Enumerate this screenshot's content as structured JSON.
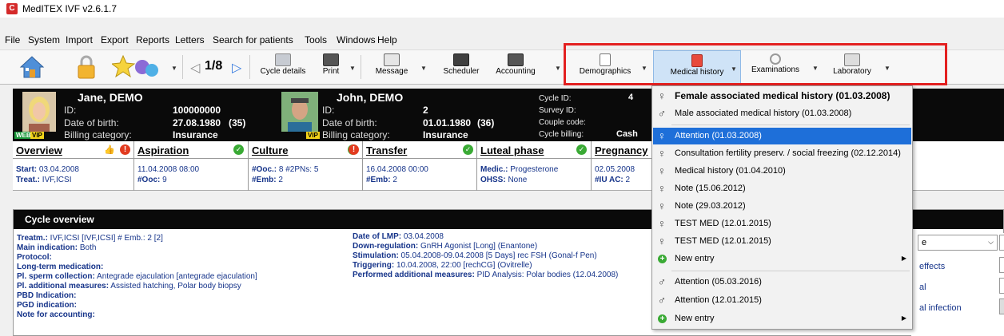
{
  "window": {
    "title": "MedITEX IVF v2.6.1.7",
    "app_icon": "C"
  },
  "menubar": [
    "File",
    "System",
    "Import",
    "Export",
    "Reports",
    "Letters",
    "Search for patients",
    "Tools",
    "Windows",
    "Help"
  ],
  "toolbar": {
    "pager": "1/8",
    "cycle_details": "Cycle details",
    "print": "Print",
    "message": "Message",
    "scheduler": "Scheduler",
    "accounting": "Accounting",
    "demographics": "Demographics",
    "medical_history": "Medical history",
    "examinations": "Examinations",
    "laboratory": "Laboratory"
  },
  "female": {
    "name": "Jane, DEMO",
    "id_label": "ID:",
    "id": "100000000",
    "dob_label": "Date of birth:",
    "dob": "27.08.1980",
    "age": "(35)",
    "billing_label": "Billing category:",
    "billing": "Insurance",
    "web_badge": "WEB",
    "vip_badge": "VIP"
  },
  "male": {
    "name": "John, DEMO",
    "id_label": "ID:",
    "id": "2",
    "dob_label": "Date of birth:",
    "dob": "01.01.1980",
    "age": "(36)",
    "billing_label": "Billing category:",
    "billing": "Insurance",
    "vip_badge": "VIP"
  },
  "cycle": {
    "cycle_id_label": "Cycle ID:",
    "cycle_id": "4",
    "survey_id_label": "Survey ID:",
    "couple_code_label": "Couple code:",
    "cycle_billing_label": "Cycle billing:",
    "cycle_billing": "Cash"
  },
  "phases": [
    {
      "title": "Overview",
      "l1a": "Start:",
      "l1b": " 03.04.2008",
      "l2a": "Treat.:",
      "l2b": " IVF,ICSI"
    },
    {
      "title": "Aspiration",
      "l1a": "",
      "l1b": "11.04.2008 08:00",
      "l2a": "#Ooc:",
      "l2b": " 9"
    },
    {
      "title": "Culture",
      "l1a": "#Ooc.:",
      "l1b": " 8 #2PNs: 5",
      "l2a": "#Emb:",
      "l2b": " 2"
    },
    {
      "title": "Transfer",
      "l1a": "",
      "l1b": "16.04.2008 00:00",
      "l2a": "#Emb:",
      "l2b": " 2"
    },
    {
      "title": "Luteal phase",
      "l1a": "Medic.:",
      "l1b": " Progesterone",
      "l2a": "OHSS:",
      "l2b": " None"
    },
    {
      "title": "Pregnancy",
      "l1a": "",
      "l1b": "02.05.2008",
      "l2a": "#IU AC:",
      "l2b": " 2"
    }
  ],
  "overview": {
    "header": "Cycle overview",
    "left": [
      {
        "k": "Treatm.:",
        "v": " IVF,ICSI    [IVF,ICSI]      # Emb.: 2    [2]"
      },
      {
        "k": "Main indication:",
        "v": " Both"
      },
      {
        "k": "Protocol:",
        "v": ""
      },
      {
        "k": "Long-term medication:",
        "v": ""
      },
      {
        "k": "Pl. sperm collection:",
        "v": " Antegrade ejaculation     [antegrade ejaculation]"
      },
      {
        "k": "Pl. additional measures:",
        "v": " Assisted hatching, Polar body biopsy"
      },
      {
        "k": "PBD Indication:",
        "v": ""
      },
      {
        "k": "PGD indication:",
        "v": ""
      },
      {
        "k": "Note for accounting:",
        "v": ""
      }
    ],
    "right": [
      {
        "k": "Date of LMP:",
        "v": " 03.04.2008"
      },
      {
        "k": "Down-regulation:",
        "v": " GnRH Agonist [Long] (Enantone)"
      },
      {
        "k": "Stimulation:",
        "v": " 05.04.2008-09.04.2008 [5 Days] rec FSH (Gonal-f Pen)"
      },
      {
        "k": "Triggering:",
        "v": " 10.04.2008, 22:00  [rechCG] (Ovitrelle)"
      },
      {
        "k": "Performed additional measures:",
        "v": " PID Analysis: Polar bodies (12.04.2008)"
      }
    ]
  },
  "right_panel": {
    "select_value": "e",
    "labels": [
      "effects",
      "al",
      "al infection"
    ]
  },
  "dropdown": {
    "female_header": "Female associated medical history (01.03.2008)",
    "male_header": "Male associated medical history (01.03.2008)",
    "female_items": [
      "Attention (01.03.2008)",
      "Consultation fertility preserv. / social freezing (02.12.2014)",
      "Medical history (01.04.2010)",
      "Note (15.06.2012)",
      "Note (29.03.2012)",
      "TEST MED (12.01.2015)",
      "TEST MED (12.01.2015)"
    ],
    "new_entry": "New entry",
    "male_items": [
      "Attention (05.03.2016)",
      "Attention (12.01.2015)"
    ],
    "new_entry_2": "New entry",
    "colors": {
      "selected": "#1e6fd9",
      "highlight_box": "#e32020"
    }
  }
}
